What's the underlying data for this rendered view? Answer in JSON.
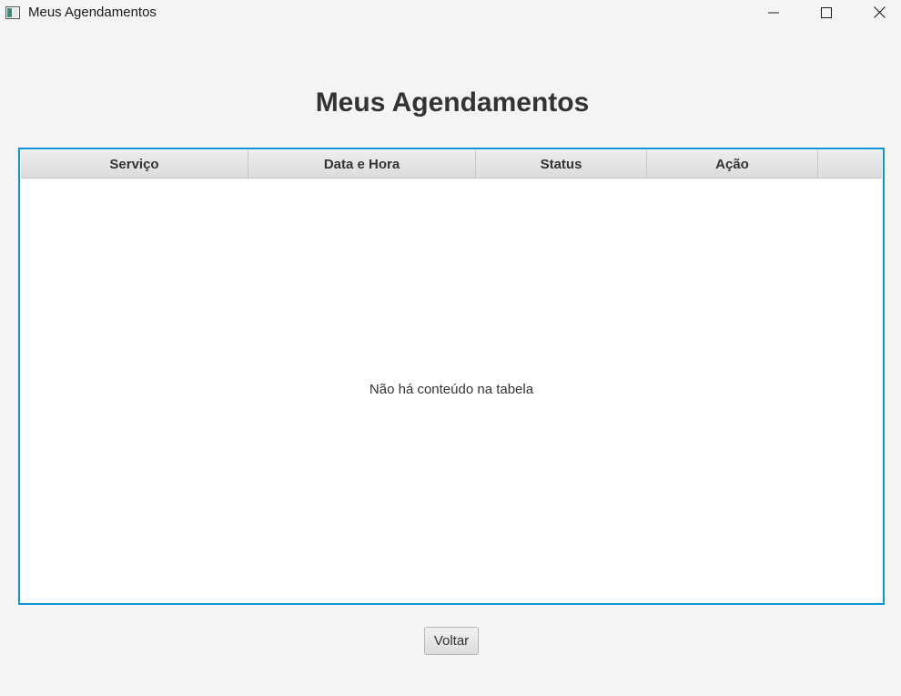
{
  "window": {
    "title": "Meus Agendamentos",
    "controls": {
      "minimize_icon": "minimize-icon",
      "maximize_icon": "maximize-icon",
      "close_icon": "close-icon"
    }
  },
  "main": {
    "heading": "Meus Agendamentos",
    "table": {
      "columns": [
        "Serviço",
        "Data e Hora",
        "Status",
        "Ação"
      ],
      "rows": [],
      "empty_message": "Não há conteúdo na tabela"
    },
    "back_button_label": "Voltar"
  },
  "colors": {
    "table_focus_border": "#0a96d6",
    "background": "#f4f4f4",
    "text": "#333333"
  }
}
